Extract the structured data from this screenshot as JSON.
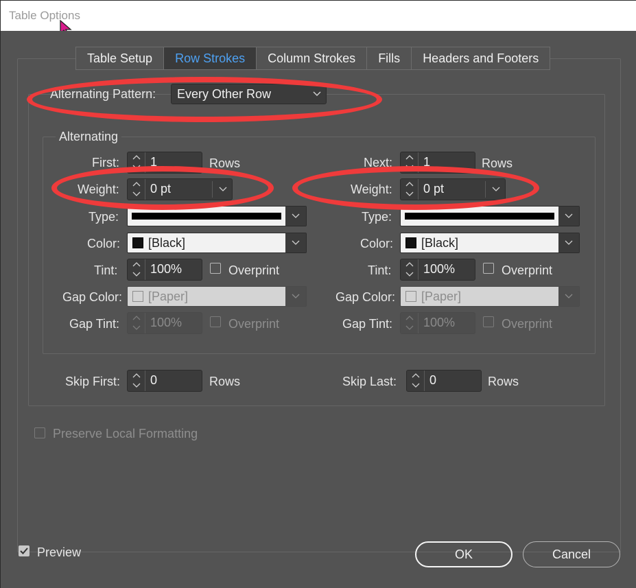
{
  "window": {
    "title": "Table Options"
  },
  "tabs": [
    {
      "label": "Table Setup",
      "active": false
    },
    {
      "label": "Row Strokes",
      "active": true
    },
    {
      "label": "Column Strokes",
      "active": false
    },
    {
      "label": "Fills",
      "active": false
    },
    {
      "label": "Headers and Footers",
      "active": false
    }
  ],
  "alternating_pattern": {
    "label": "Alternating Pattern:",
    "value": "Every Other Row"
  },
  "alternating": {
    "legend": "Alternating",
    "left": {
      "count_label": "First:",
      "count_value": "1",
      "count_unit": "Rows",
      "weight_label": "Weight:",
      "weight_value": "0 pt",
      "type_label": "Type:",
      "color_label": "Color:",
      "color_value": "[Black]",
      "tint_label": "Tint:",
      "tint_value": "100%",
      "overprint_label": "Overprint",
      "gap_color_label": "Gap Color:",
      "gap_color_value": "[Paper]",
      "gap_tint_label": "Gap Tint:",
      "gap_tint_value": "100%",
      "gap_overprint_label": "Overprint"
    },
    "right": {
      "count_label": "Next:",
      "count_value": "1",
      "count_unit": "Rows",
      "weight_label": "Weight:",
      "weight_value": "0 pt",
      "type_label": "Type:",
      "color_label": "Color:",
      "color_value": "[Black]",
      "tint_label": "Tint:",
      "tint_value": "100%",
      "overprint_label": "Overprint",
      "gap_color_label": "Gap Color:",
      "gap_color_value": "[Paper]",
      "gap_tint_label": "Gap Tint:",
      "gap_tint_value": "100%",
      "gap_overprint_label": "Overprint"
    }
  },
  "skip": {
    "first_label": "Skip First:",
    "first_value": "0",
    "first_unit": "Rows",
    "last_label": "Skip Last:",
    "last_value": "0",
    "last_unit": "Rows"
  },
  "preserve_local_formatting": {
    "label": "Preserve Local Formatting",
    "checked": false,
    "enabled": false
  },
  "preview": {
    "label": "Preview",
    "checked": true
  },
  "buttons": {
    "ok": "OK",
    "cancel": "Cancel"
  },
  "colors": {
    "highlight_ellipse": "#ef3b3b",
    "active_tab_text": "#4ea1f2",
    "dialog_bg": "#535353"
  }
}
